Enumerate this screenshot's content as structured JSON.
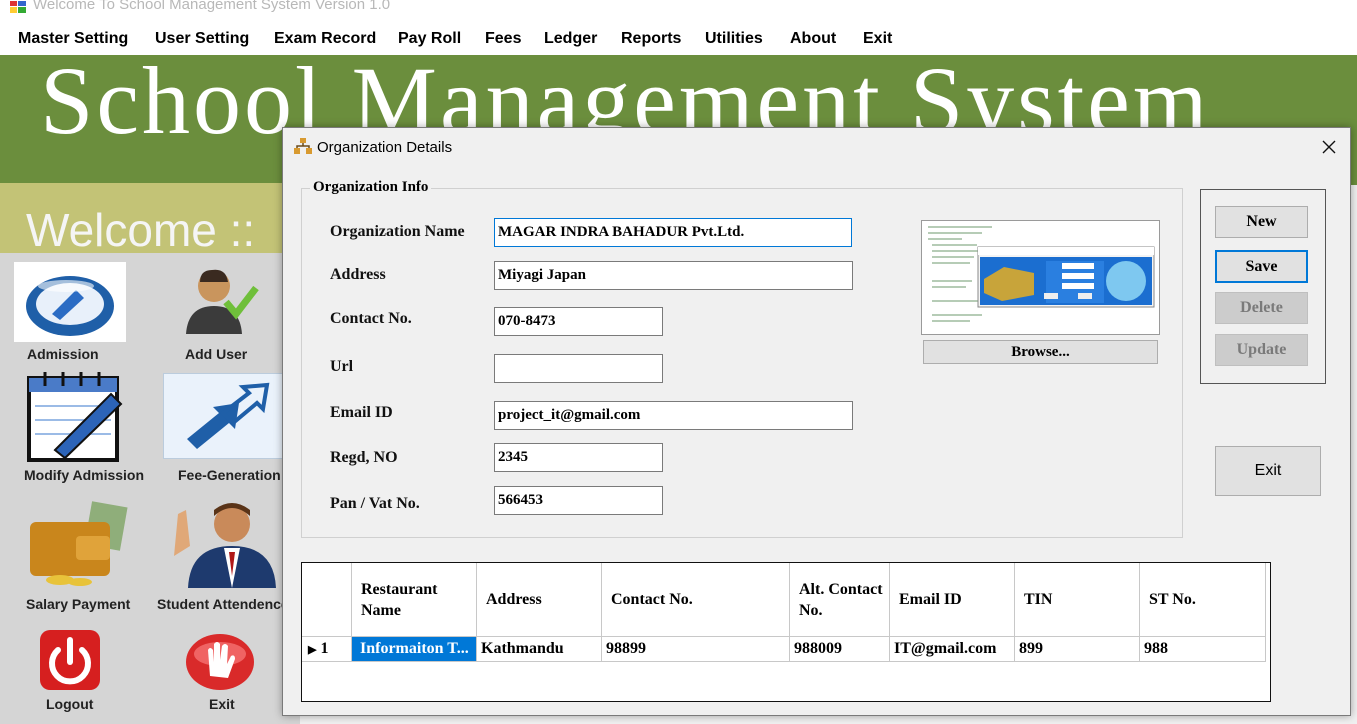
{
  "window": {
    "title": "Welcome To School Management System Version 1.0"
  },
  "menu": [
    "Master Setting",
    "User Setting",
    "Exam Record",
    "Pay Roll",
    "Fees",
    "Ledger",
    "Reports",
    "Utilities",
    "About",
    "Exit"
  ],
  "banner": {
    "text": "School Management System"
  },
  "welcome": {
    "text": "Welcome ::"
  },
  "launchers": {
    "admission": "Admission",
    "add_user": "Add User",
    "modify_admission": "Modify Admission",
    "fee_generation": "Fee-Generation",
    "salary_payment": "Salary Payment",
    "student_attendence": "Student Attendence",
    "logout": "Logout",
    "exit": "Exit"
  },
  "dialog": {
    "title": "Organization Details",
    "group_title": "Organization Info",
    "fields": {
      "org_name": {
        "label": "Organization Name",
        "value": "MAGAR INDRA BAHADUR Pvt.Ltd."
      },
      "address": {
        "label": "Address",
        "value": "Miyagi Japan"
      },
      "contact": {
        "label": "Contact No.",
        "value": "070-8473"
      },
      "url": {
        "label": "Url",
        "value": ""
      },
      "email": {
        "label": "Email ID",
        "value": "project_it@gmail.com"
      },
      "regd": {
        "label": "Regd, NO",
        "value": "2345"
      },
      "pan": {
        "label": "Pan / Vat No.",
        "value": "566453"
      }
    },
    "browse_label": "Browse...",
    "buttons": {
      "new": "New",
      "save": "Save",
      "delete": "Delete",
      "update": "Update",
      "exit": "Exit"
    },
    "grid": {
      "columns": [
        "Restaurant Name",
        "Address",
        "Contact No.",
        "Alt. Contact No.",
        "Email ID",
        "TIN",
        "ST No."
      ],
      "rows": [
        {
          "index": "1",
          "cells": [
            "Informaiton T...",
            "Kathmandu",
            "98899",
            "988009",
            "IT@gmail.com",
            "899",
            "988"
          ]
        }
      ]
    }
  },
  "colors": {
    "banner": "#6b8e3d",
    "welcome_band": "#c3c376",
    "accent": "#0078d7"
  }
}
